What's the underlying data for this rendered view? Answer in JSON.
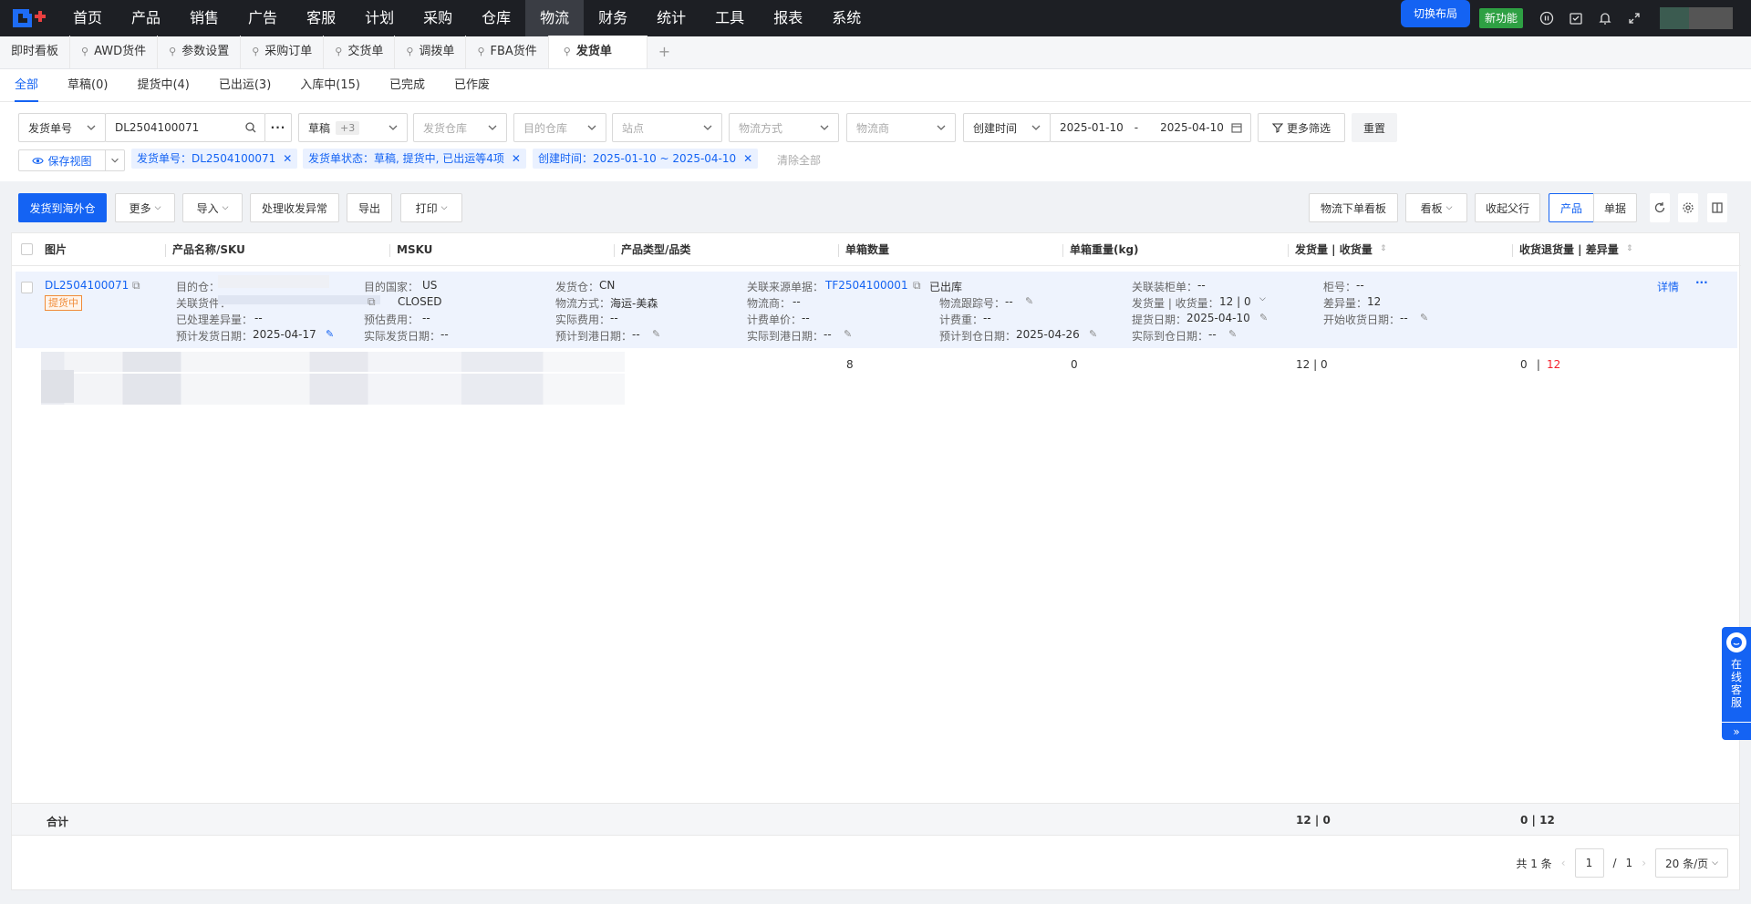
{
  "topnav": {
    "items": [
      "首页",
      "产品",
      "销售",
      "广告",
      "客服",
      "计划",
      "采购",
      "仓库",
      "物流",
      "财务",
      "统计",
      "工具",
      "报表",
      "系统"
    ],
    "active_index": 8,
    "switch_layout": "切换布局",
    "new_feature": "新功能"
  },
  "page_tabs": [
    {
      "label": "即时看板",
      "pinned": false
    },
    {
      "label": "AWD货件",
      "pinned": true
    },
    {
      "label": "参数设置",
      "pinned": true
    },
    {
      "label": "采购订单",
      "pinned": true
    },
    {
      "label": "交货单",
      "pinned": true
    },
    {
      "label": "调拨单",
      "pinned": true
    },
    {
      "label": "FBA货件",
      "pinned": true
    },
    {
      "label": "发货单",
      "pinned": true,
      "active": true
    }
  ],
  "status_tabs": [
    "全部",
    "草稿(0)",
    "提货中(4)",
    "已出运(3)",
    "入库中(15)",
    "已完成",
    "已作废"
  ],
  "filters": {
    "search_type": "发货单号",
    "search_value": "DL2504100071",
    "status_select": "草稿",
    "status_more": "+3",
    "ship_warehouse_ph": "发货仓库",
    "dest_warehouse_ph": "目的仓库",
    "site_ph": "站点",
    "logistics_method_ph": "物流方式",
    "carrier_ph": "物流商",
    "time_type": "创建时间",
    "date_from": "2025-01-10",
    "date_sep": "-",
    "date_to": "2025-04-10",
    "more_filters": "更多筛选",
    "reset": "重置",
    "save_view": "保存视图",
    "chips": [
      "发货单号：DL2504100071",
      "发货单状态：草稿, 提货中, 已出运等4项",
      "创建时间：2025-01-10 ~ 2025-04-10"
    ],
    "clear_all": "清除全部"
  },
  "toolbar": {
    "ship_overseas": "发货到海外仓",
    "more": "更多",
    "import": "导入",
    "handle_exception": "处理收发异常",
    "export": "导出",
    "print": "打印",
    "logistics_board": "物流下单看板",
    "board": "看板",
    "collapse_parent": "收起父行",
    "view_product": "产品",
    "view_doc": "单据"
  },
  "table": {
    "headers": [
      "图片",
      "产品名称/SKU",
      "MSKU",
      "产品类型/品类",
      "单箱数量",
      "单箱重量(kg)",
      "发货量 | 收货量",
      "收货退货量 | 差异量"
    ],
    "parent": {
      "order_no": "DL2504100071",
      "status_tag": "提货中",
      "dest_warehouse_label": "目的仓：",
      "related_shipment_label": "关联货件：",
      "pending_diff_label": "已处理差异量：",
      "pending_diff": "--",
      "est_ship_date_label": "预计发货日期：",
      "est_ship_date": "2025-04-17",
      "dest_country_label": "目的国家：",
      "dest_country": "US",
      "closed": "CLOSED",
      "est_fee_label": "预估费用：",
      "est_fee": "--",
      "actual_ship_date_label": "实际发货日期：",
      "actual_ship_date": "--",
      "ship_wh_label": "发货仓：",
      "ship_wh": "CN",
      "method_label": "物流方式：",
      "method": "海运-美森",
      "actual_fee_label": "实际费用：",
      "actual_fee": "--",
      "est_port_label": "预计到港日期：",
      "est_port": "--",
      "src_doc_label": "关联来源单据：",
      "src_doc": "TF2504100001",
      "src_status": "已出库",
      "carrier_label": "物流商：",
      "carrier": "--",
      "unit_price_label": "计费单价：",
      "unit_price": "--",
      "actual_port_label": "实际到港日期：",
      "actual_port": "--",
      "tracking_label": "物流跟踪号：",
      "tracking": "--",
      "billed_weight_label": "计费重：",
      "billed_weight": "--",
      "est_wh_label": "预计到仓日期：",
      "est_wh": "2025-04-26",
      "container_doc_label": "关联装柜单：",
      "container_doc": "--",
      "ship_recv_label": "发货量 | 收货量：",
      "ship_recv": "12 | 0",
      "pickup_label": "提货日期：",
      "pickup": "2025-04-10",
      "actual_wh_label": "实际到仓日期：",
      "actual_wh": "--",
      "container_no_label": "柜号：",
      "container_no": "--",
      "diff_label": "差异量：",
      "diff": "12",
      "start_recv_label": "开始收货日期：",
      "start_recv": "--",
      "detail": "详情"
    },
    "child": {
      "box_qty": "8",
      "box_weight": "0",
      "ship_recv": "12  |  0",
      "return_qty": "0",
      "diff_qty": "12"
    },
    "footer": {
      "label": "合计",
      "ship_recv": "12 | 0",
      "return_diff": "0 | 12"
    }
  },
  "pagination": {
    "total": "共 1 条",
    "current": "1",
    "sep": "/",
    "pages": "1",
    "page_size": "20 条/页"
  },
  "chat_widget": "在线客服",
  "colors": {
    "primary": "#1463f3",
    "topbar": "#1d1f24",
    "tag_orange": "#f08c3a",
    "diff_red": "#f5222d"
  }
}
